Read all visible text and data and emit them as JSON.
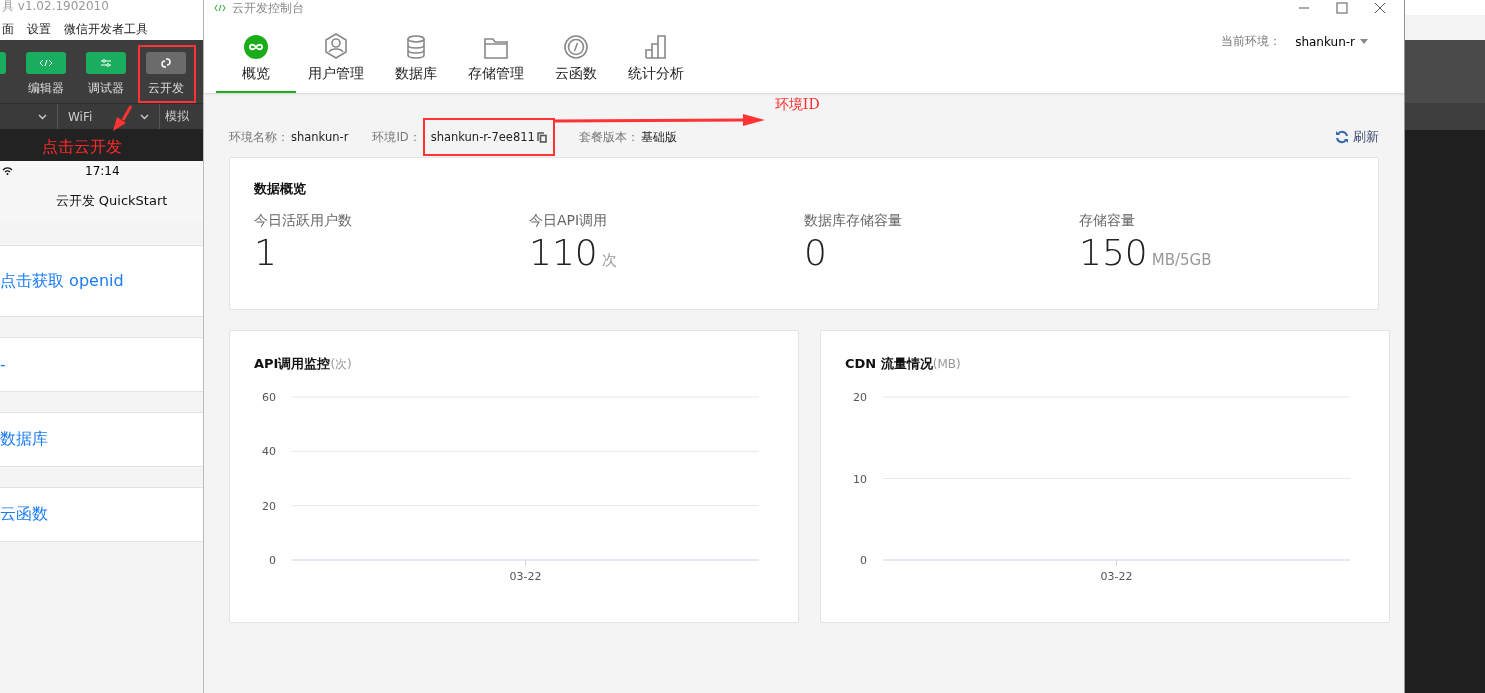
{
  "devtools": {
    "title": "具 v1.02.1902010",
    "menu": [
      "面",
      "设置",
      "微信开发者工具"
    ],
    "toolbar": [
      {
        "label": "编辑器",
        "selected": false
      },
      {
        "label": "调试器",
        "selected": false
      },
      {
        "label": "云开发",
        "selected": true
      }
    ],
    "network": "WiFi",
    "simulate": "模拟",
    "phone": {
      "time": "17:14",
      "nav_title": "云开发 QuickStart",
      "cells": [
        "点击获取 openid",
        "-",
        "数据库",
        "云函数"
      ]
    }
  },
  "console": {
    "title": "云开发控制台",
    "tabs": [
      {
        "label": "概览",
        "selected": true
      },
      {
        "label": "用户管理",
        "selected": false
      },
      {
        "label": "数据库",
        "selected": false
      },
      {
        "label": "存储管理",
        "selected": false
      },
      {
        "label": "云函数",
        "selected": false
      },
      {
        "label": "统计分析",
        "selected": false
      }
    ],
    "env_label": "当前环境：",
    "env_value": "shankun-r",
    "info": [
      {
        "label": "环境名称：",
        "value": "shankun-r"
      },
      {
        "label": "环境ID：",
        "value": "shankun-r-7ee811",
        "copy": true
      },
      {
        "label": "套餐版本：",
        "value": "基础版"
      }
    ],
    "refresh": "刷新",
    "overview": {
      "title": "数据概览",
      "stats": [
        {
          "label": "今日活跃用户数",
          "value": "1"
        },
        {
          "label": "今日API调用",
          "value": "110",
          "unit": "次"
        },
        {
          "label": "数据库存储容量",
          "value": "0"
        },
        {
          "label": "存储容量",
          "value": "150",
          "unit": "MB/5GB"
        }
      ]
    },
    "charts": [
      {
        "title": "API调用监控",
        "unit": "(次)",
        "chart_data": {
          "type": "line",
          "categories": [
            "03-22"
          ],
          "ylim": [
            0,
            60
          ],
          "yticks": [
            0,
            20,
            40,
            60
          ]
        }
      },
      {
        "title": "CDN 流量情况",
        "unit": "(MB)",
        "chart_data": {
          "type": "line",
          "categories": [
            "03-22"
          ],
          "ylim": [
            0,
            20
          ],
          "yticks": [
            0,
            10,
            20
          ]
        }
      }
    ]
  },
  "annotations": [
    {
      "text": "点击云开发"
    },
    {
      "text": "环境ID"
    }
  ]
}
